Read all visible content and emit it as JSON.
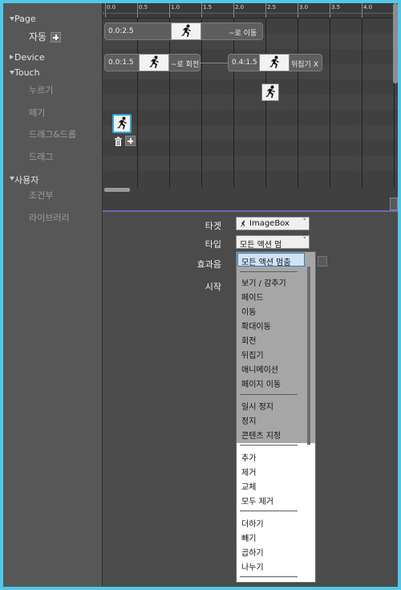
{
  "tree": {
    "page_label": "Page",
    "page_item": "자동",
    "device_label": "Device",
    "touch_label": "Touch",
    "touch_items": [
      "누르기",
      "떼기",
      "드래그&드롭",
      "드래그"
    ],
    "user_label": "사용자",
    "user_items": [
      "조건부",
      "라이브러리"
    ]
  },
  "ruler": {
    "ticks": [
      "0.0",
      "0.5",
      "1.0",
      "1.5",
      "2.0",
      "2.5",
      "3.0",
      "3.5",
      "4.0"
    ]
  },
  "clips": {
    "move": {
      "start": "0.0:2.5",
      "label": "~로 이동"
    },
    "rotate": {
      "start": "0.0:1.5",
      "label": "~로 회전"
    },
    "flip": {
      "start": "0.4:1.5",
      "label": "뒤집기 X"
    }
  },
  "props": {
    "target_label": "타겟",
    "target_value": "ImageBox",
    "type_label": "타입",
    "type_value": "모든 액션 멈",
    "sound_label": "효과음",
    "start_label": "시작"
  },
  "dropdown": {
    "selected": "모든 액션 멈춤",
    "group1": [
      "보기 / 감추기",
      "페이드",
      "이동",
      "확대이동",
      "회전",
      "뒤집기",
      "애니메이션",
      "페이지 이동"
    ],
    "group2": [
      "일시 정지",
      "정지",
      "콘텐츠 지정"
    ],
    "group3": [
      "추가",
      "제거",
      "교체",
      "모두 제거"
    ],
    "group4": [
      "더하기",
      "빼기",
      "곱하기",
      "나누기"
    ]
  },
  "colors": {
    "frame": "#53c7e8",
    "selection_border": "#2f7bc1",
    "separator": "#6b6bb5"
  },
  "icons": [
    "running-man-icon",
    "plus-icon",
    "trash-icon",
    "chevron-down-icon"
  ]
}
